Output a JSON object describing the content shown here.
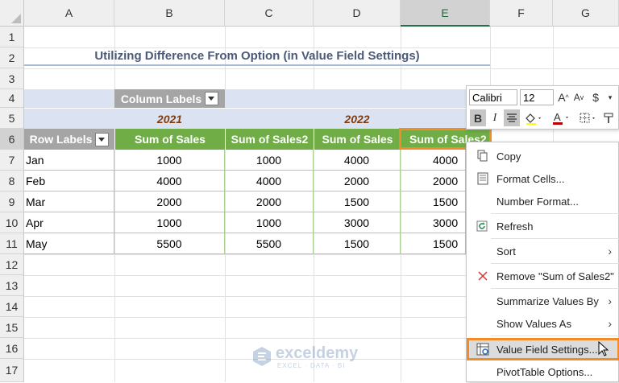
{
  "columns": [
    "A",
    "B",
    "C",
    "D",
    "E",
    "F",
    "G"
  ],
  "rows": [
    "1",
    "2",
    "3",
    "4",
    "5",
    "6",
    "7",
    "8",
    "9",
    "10",
    "11",
    "12",
    "13",
    "14",
    "15",
    "16",
    "17"
  ],
  "title": "Utilizing Difference From Option (in Value Field Settings)",
  "pivot": {
    "column_labels": "Column Labels",
    "year1": "2021",
    "year2": "2022",
    "row_labels": "Row Labels",
    "headers": [
      "Sum of Sales",
      "Sum of Sales2",
      "Sum of Sales",
      "Sum of Sales2"
    ],
    "data": [
      {
        "label": "Jan",
        "values": [
          "1000",
          "1000",
          "4000",
          "4000"
        ]
      },
      {
        "label": "Feb",
        "values": [
          "4000",
          "4000",
          "2000",
          "2000"
        ]
      },
      {
        "label": "Mar",
        "values": [
          "2000",
          "2000",
          "1500",
          "1500"
        ]
      },
      {
        "label": "Apr",
        "values": [
          "1000",
          "1000",
          "3000",
          "3000"
        ]
      },
      {
        "label": "May",
        "values": [
          "5500",
          "5500",
          "1500",
          "1500"
        ]
      }
    ]
  },
  "mini_toolbar": {
    "font": "Calibri",
    "size": "12",
    "grow": "A",
    "shrink": "A",
    "currency": "$",
    "percent": "%",
    "bold": "B",
    "italic": "I"
  },
  "menu": {
    "copy": "Copy",
    "format_cells": "Format Cells...",
    "number_format": "Number Format...",
    "refresh": "Refresh",
    "sort": "Sort",
    "remove": "Remove \"Sum of Sales2\"",
    "summarize": "Summarize Values By",
    "show_values": "Show Values As",
    "value_field_settings": "Value Field Settings...",
    "pivot_options": "PivotTable Options..."
  },
  "watermark": {
    "name": "exceldemy",
    "tagline": "EXCEL · DATA · BI"
  },
  "colors": {
    "highlight": "#f28c28",
    "pivot_green": "#70ad47",
    "pivot_blue": "#dbe3f3",
    "excel_green": "#217346"
  }
}
